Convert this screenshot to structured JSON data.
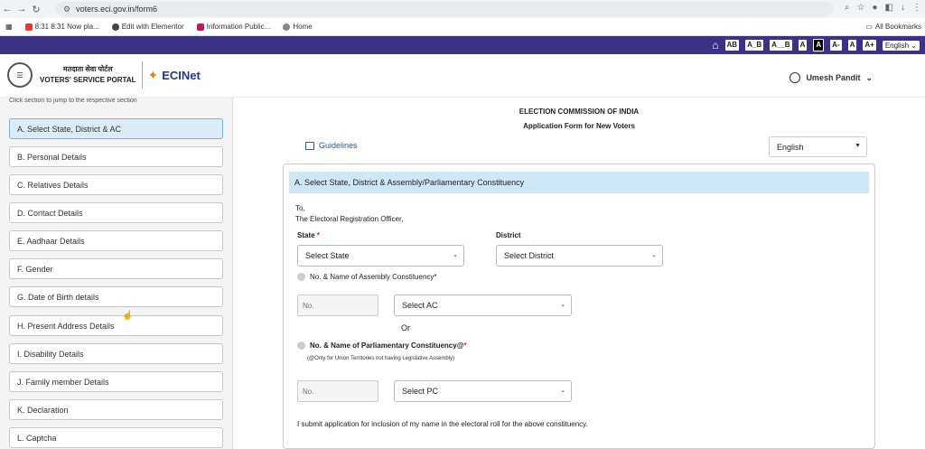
{
  "browser": {
    "url": "voters.eci.gov.in/form6",
    "bookmarks": [
      {
        "label": "8:31 8:31 Now pla..."
      },
      {
        "label": "Edit with Elementor"
      },
      {
        "label": "Information Public..."
      },
      {
        "label": "Home"
      }
    ],
    "all_bookmarks": "All Bookmarks"
  },
  "a11y": {
    "buttons": [
      "AB",
      "A_B",
      "A__B",
      "A",
      "A",
      "A-",
      "A",
      "A+"
    ],
    "language": "English"
  },
  "header": {
    "portal_hindi": "मतदाता सेवा पोर्टल",
    "portal_english": "VOTERS' SERVICE PORTAL",
    "ecinet": "ECINet",
    "user_name": "Umesh Pandit"
  },
  "sidebar": {
    "hint": "Click section to jump to the respective section",
    "items": [
      {
        "label": "A. Select State, District & AC"
      },
      {
        "label": "B. Personal Details"
      },
      {
        "label": "C. Relatives Details"
      },
      {
        "label": "D. Contact Details"
      },
      {
        "label": "E. Aadhaar Details"
      },
      {
        "label": "F. Gender"
      },
      {
        "label": "G. Date of Birth details"
      },
      {
        "label": "H. Present Address Details"
      },
      {
        "label": "I. Disability Details"
      },
      {
        "label": "J. Family member Details"
      },
      {
        "label": "K. Declaration"
      },
      {
        "label": "L. Captcha"
      }
    ]
  },
  "main": {
    "org": "ELECTION COMMISSION OF INDIA",
    "form_title": "Application Form for New Voters",
    "guidelines": "Guidelines",
    "language": "English",
    "section_title": "A. Select State, District & Assembly/Parliamentary Constituency",
    "to": "To,",
    "officer": "The Electoral Registration Officer,",
    "state_label": "State",
    "state_req": "*",
    "state_select": "Select State",
    "district_label": "District",
    "district_select": "Select District",
    "ac_label": "No. & Name of Assembly Constituency*",
    "ac_no_placeholder": "No.",
    "ac_select": "Select AC",
    "or": "Or",
    "pc_label": "No. & Name of Parliamentary Constituency@",
    "pc_req": "*",
    "pc_note": "(@Only for Union Territories not having Legislative Assembly)",
    "pc_no_placeholder": "No.",
    "pc_select": "Select PC",
    "submit_text": "I submit application for inclusion of my name in the electoral roll for the above constituency."
  }
}
